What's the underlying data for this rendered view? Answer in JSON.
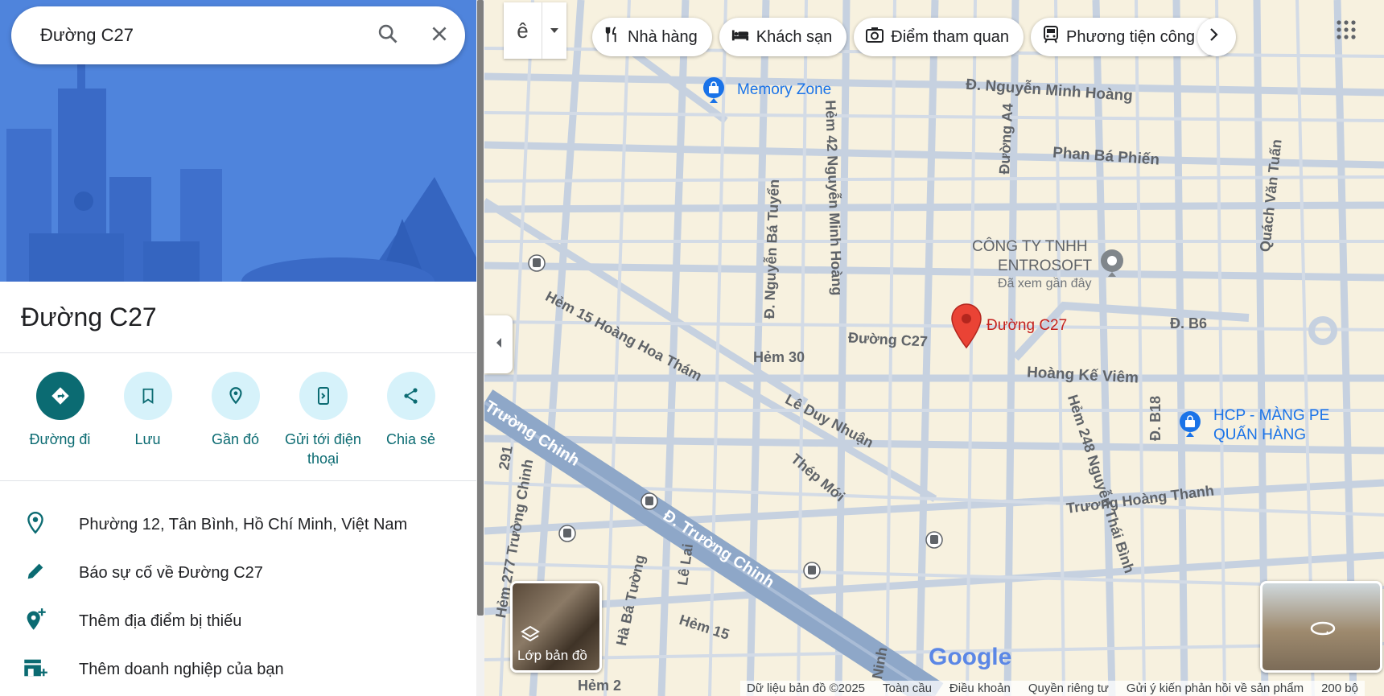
{
  "search": {
    "query": "Đường C27"
  },
  "place": {
    "title": "Đường C27"
  },
  "actions": [
    {
      "label": "Đường đi",
      "icon": "directions-icon"
    },
    {
      "label": "Lưu",
      "icon": "bookmark-icon"
    },
    {
      "label": "Gần đó",
      "icon": "nearby-icon"
    },
    {
      "label": "Gửi tới điện thoại",
      "icon": "send-to-phone-icon"
    },
    {
      "label": "Chia sẻ",
      "icon": "share-icon"
    }
  ],
  "info": {
    "address": "Phường 12, Tân Bình, Hồ Chí Minh, Việt Nam",
    "report": "Báo sự cố về Đường C27",
    "add_place": "Thêm địa điểm bị thiếu",
    "add_business": "Thêm doanh nghiệp của bạn"
  },
  "map": {
    "input_tool": "ê",
    "chips": [
      "Nhà hàng",
      "Khách sạn",
      "Điểm tham quan",
      "Phương tiện công c"
    ],
    "streets": {
      "nguyen_minh_hoang": "Đ. Nguyễn Minh Hoàng",
      "phan_ba_phien": "Phan Bá Phiến",
      "duong_a4": "Đường A4",
      "hem42": "Hẻm 42 Nguyễn Minh Hoàng",
      "nguyen_ba_tuyen": "Đ. Nguyễn Bá Tuyển",
      "quach_van_tuan": "Quách Văn Tuấn",
      "hem15": "Hẻm 15 Hoàng Hoa Thám",
      "hem30": "Hẻm 30",
      "duong_c27_street": "Đường C27",
      "b6": "Đ. B6",
      "hoang_ke_viem": "Hoàng Kế Viêm",
      "le_duy_nhuan": "Lê Duy Nhuận",
      "thep_moi": "Thép Mới",
      "truong_chinh": "Trường Chinh",
      "d_truong_chinh": "Đ. Trường Chinh",
      "hem248": "Hẻm 248 Nguyễn Thái Bình",
      "d_b18": "Đ. B18",
      "truong_hoang_thanh": "Trương Hoàng Thanh",
      "s291": "291",
      "hem277": "Hẻm 277 Trường Chinh",
      "ba_tuong": "Hà Bá Tường",
      "le_lai": "Lê Lai",
      "hem15b": "Hẻm 15",
      "ninh": "Ninh",
      "ong_bot": "Hẻm 2"
    },
    "pois": {
      "memory_zone": "Memory Zone",
      "entrosoft_1": "CÔNG TY TNHH",
      "entrosoft_2": "ENTROSOFT",
      "entrosoft_sub": "Đã xem gần đây",
      "pin_label": "Đường C27",
      "hcp_1": "HCP - MÀNG PE",
      "hcp_2": "QUẤN HÀNG"
    },
    "layer_label": "Lớp bản đồ",
    "google": "Google",
    "footer": [
      "Dữ liệu bản đồ ©2025",
      "Toàn cầu",
      "Điều khoản",
      "Quyền riêng tư",
      "Gửi ý kiến phản hồi về sản phẩm",
      "200 bộ"
    ],
    "colors": {
      "accent": "#0b6b72",
      "pin": "#ea4335",
      "road": "#c5d0de",
      "block": "#f7f1df"
    }
  }
}
